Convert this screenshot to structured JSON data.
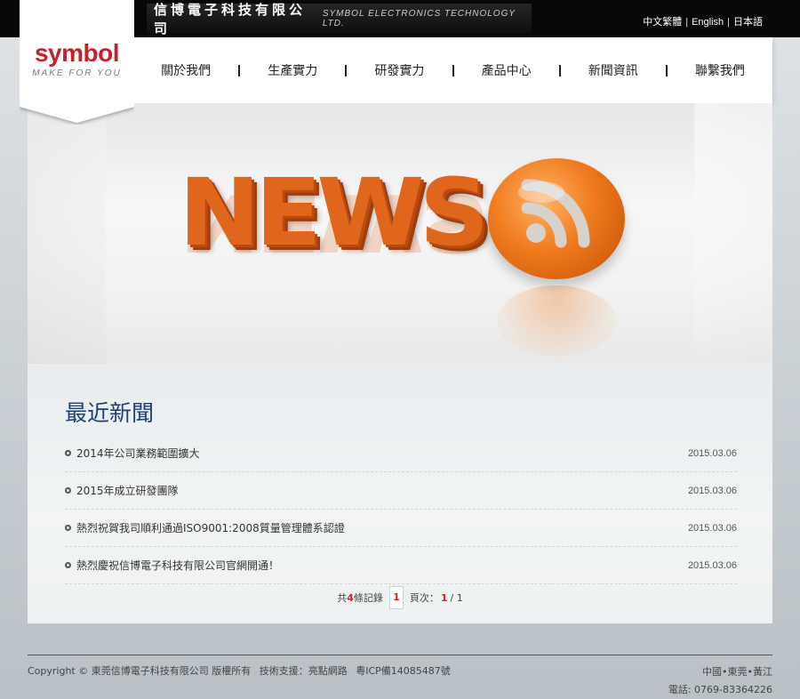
{
  "header": {
    "company_cn": "信博電子科技有限公司",
    "company_en": "SYMBOL ELECTRONICS TECHNOLOGY LTD.",
    "languages": [
      "中文繁體",
      "English",
      "日本語"
    ],
    "lang_separator": "|"
  },
  "logo": {
    "word": "symbol",
    "slogan": "MAKE FOR YOU",
    "brand_color": "#c4202e"
  },
  "nav": {
    "items": [
      "關於我們",
      "生產實力",
      "研發實力",
      "產品中心",
      "新聞資訊",
      "聯繫我們"
    ],
    "separator": "|"
  },
  "banner": {
    "text": "NEWS",
    "icon": "rss-icon",
    "accent": "#e0661c"
  },
  "content": {
    "title": "最近新聞",
    "news": [
      {
        "title": "2014年公司業務範圍擴大",
        "date": "2015.03.06"
      },
      {
        "title": "2015年成立研發團隊",
        "date": "2015.03.06"
      },
      {
        "title": "熱烈祝賀我司順利通過ISO9001:2008質量管理體系認證",
        "date": "2015.03.06"
      },
      {
        "title": "熱烈慶祝信博電子科技有限公司官網開通！",
        "date": "2015.03.06"
      }
    ],
    "pager": {
      "total_prefix": "共",
      "total_count": "4",
      "total_suffix": "條記錄",
      "current_page_box": "1",
      "page_label": "頁次：",
      "page_current": "1",
      "page_total": "/ 1"
    }
  },
  "footer": {
    "copyright": "Copyright © 東莞信博電子科技有限公司 版權所有",
    "tech_support": "技術支援：亮點網路",
    "icp": "粵ICP備14085487號",
    "location": "中國•東莞•黃江",
    "phone": "電話: 0769-83364226"
  }
}
